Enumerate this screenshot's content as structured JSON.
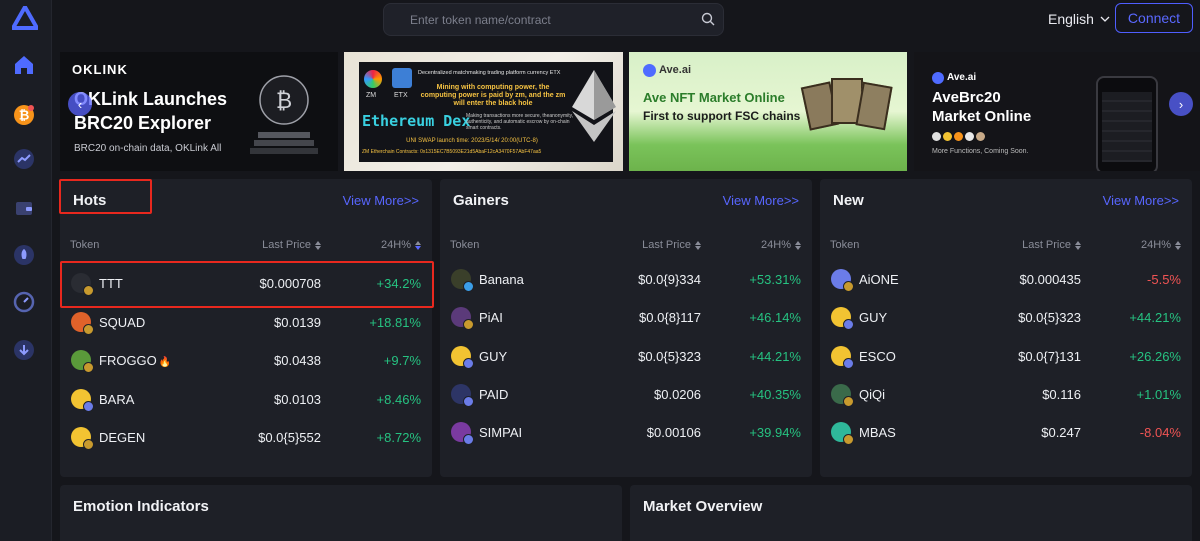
{
  "header": {
    "search_placeholder": "Enter token name/contract",
    "language": "English",
    "connect_label": "Connect"
  },
  "banners": [
    {
      "brand": "OKLINK",
      "title_line1": "OKLink Launches",
      "title_line2": "BRC20 Explorer",
      "subtitle": "BRC20 on-chain data, OKLink All"
    },
    {
      "tag_left": "ZM",
      "tag_right": "ETX",
      "top_text": "Decentralized matchmaking trading platform currency ETX",
      "mining_text": "Mining with computing power, the computing power is paid by zm, and the zm will enter the black hole",
      "title": "Ethereum Dex",
      "desc": "Making transactions more secure, theanonymity, authenticity, and automatic escrow by on-chain smart contracts.",
      "launch": "UNI SWAP launch time: 2023/5/14/ 20:00(UTC-8)",
      "contracts": "ZM Etherchain Contracts: 0x1315EC7B5093E21d5AbaF12cA3470F57AbF47aa5"
    },
    {
      "brand": "Ave.ai",
      "title": "Ave NFT Market Online",
      "subtitle": "First to support FSC chains"
    },
    {
      "brand": "Ave.ai",
      "title_line1": "AveBrc20",
      "title_line2": "Market Online",
      "subtitle": "More Functions, Coming Soon."
    }
  ],
  "panels": {
    "hots": {
      "title": "Hots",
      "view_more": "View More>>",
      "col_token": "Token",
      "col_price": "Last Price",
      "col_change": "24H%",
      "rows": [
        {
          "name": "TTT",
          "price": "$0.000708",
          "change": "+34.2%",
          "dir": "pos",
          "color": "#2a2c33",
          "chain": "#c89a2e"
        },
        {
          "name": "SQUAD",
          "price": "$0.0139",
          "change": "+18.81%",
          "dir": "pos",
          "color": "#e0622a",
          "chain": "#c89a2e"
        },
        {
          "name": "FROGGO",
          "price": "$0.0438",
          "change": "+9.7%",
          "dir": "pos",
          "color": "#5a9a3a",
          "chain": "#c89a2e",
          "badge": "🔥"
        },
        {
          "name": "BARA",
          "price": "$0.0103",
          "change": "+8.46%",
          "dir": "pos",
          "color": "#f2c332",
          "chain": "#6b7ce8"
        },
        {
          "name": "DEGEN",
          "price": "$0.0{5}552",
          "change": "+8.72%",
          "dir": "pos",
          "color": "#f2c332",
          "chain": "#c89a2e"
        }
      ]
    },
    "gainers": {
      "title": "Gainers",
      "view_more": "View More>>",
      "col_token": "Token",
      "col_price": "Last Price",
      "col_change": "24H%",
      "rows": [
        {
          "name": "Banana",
          "price": "$0.0{9}334",
          "change": "+53.31%",
          "dir": "pos",
          "color": "#3a3f2a",
          "chain": "#3b9ee8"
        },
        {
          "name": "PiAI",
          "price": "$0.0{8}117",
          "change": "+46.14%",
          "dir": "pos",
          "color": "#5b3a7a",
          "chain": "#c89a2e"
        },
        {
          "name": "GUY",
          "price": "$0.0{5}323",
          "change": "+44.21%",
          "dir": "pos",
          "color": "#f2c332",
          "chain": "#6b7ce8"
        },
        {
          "name": "PAID",
          "price": "$0.0206",
          "change": "+40.35%",
          "dir": "pos",
          "color": "#2d3566",
          "chain": "#6b7ce8"
        },
        {
          "name": "SIMPAI",
          "price": "$0.00106",
          "change": "+39.94%",
          "dir": "pos",
          "color": "#7a3aa0",
          "chain": "#6b7ce8"
        }
      ]
    },
    "new": {
      "title": "New",
      "view_more": "View More>>",
      "col_token": "Token",
      "col_price": "Last Price",
      "col_change": "24H%",
      "rows": [
        {
          "name": "AiONE",
          "price": "$0.000435",
          "change": "-5.5%",
          "dir": "neg",
          "color": "#6b7ce8",
          "chain": "#c89a2e"
        },
        {
          "name": "GUY",
          "price": "$0.0{5}323",
          "change": "+44.21%",
          "dir": "pos",
          "color": "#f2c332",
          "chain": "#6b7ce8"
        },
        {
          "name": "ESCO",
          "price": "$0.0{7}131",
          "change": "+26.26%",
          "dir": "pos",
          "color": "#f2c332",
          "chain": "#6b7ce8"
        },
        {
          "name": "QiQi",
          "price": "$0.116",
          "change": "+1.01%",
          "dir": "pos",
          "color": "#3a6a4a",
          "chain": "#c89a2e"
        },
        {
          "name": "MBAS",
          "price": "$0.247",
          "change": "-8.04%",
          "dir": "neg",
          "color": "#2fb89a",
          "chain": "#c89a2e"
        }
      ]
    },
    "emotion": {
      "title": "Emotion Indicators"
    },
    "market": {
      "title": "Market Overview"
    }
  },
  "colors": {
    "accent": "#5866ff",
    "positive": "#26c281",
    "negative": "#f05454",
    "highlight": "#e8281e"
  }
}
